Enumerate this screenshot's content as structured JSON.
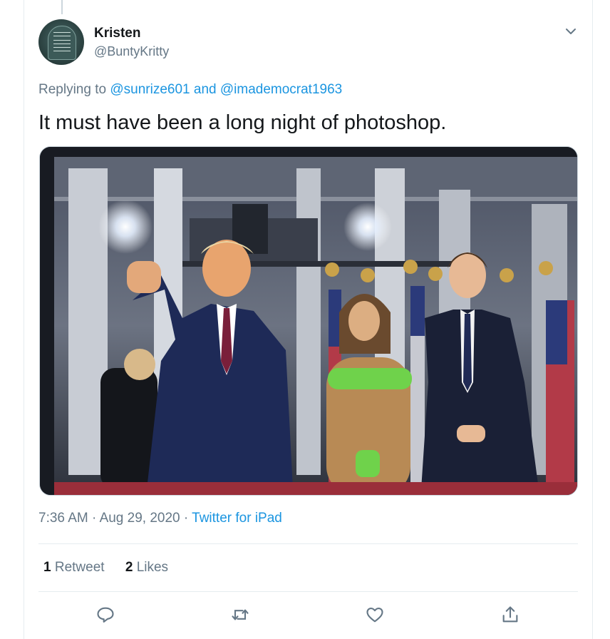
{
  "tweet": {
    "user": {
      "name": "Kristen",
      "handle": "@BuntyKritty",
      "avatar_text": "Feed the Fish 10¢"
    },
    "reply_prefix": "Replying to",
    "reply_to": [
      "@sunrize601",
      "@imademocrat1963"
    ],
    "reply_conjunction": "and",
    "text": "It must have been a long night of photoshop.",
    "time": "7:36 AM",
    "date": "Aug 29, 2020",
    "source": "Twitter for iPad",
    "separator": "·",
    "stats": {
      "retweet_count": "1",
      "retweet_label": "Retweet",
      "like_count": "2",
      "like_label": "Likes"
    }
  },
  "icons": {
    "caret": "chevron-down-icon",
    "reply": "reply-icon",
    "retweet": "retweet-icon",
    "like": "heart-icon",
    "share": "share-icon"
  },
  "colors": {
    "link": "#1b95e0",
    "secondary_text": "#657786",
    "primary_text": "#14171a",
    "border": "#e6ecf0"
  }
}
